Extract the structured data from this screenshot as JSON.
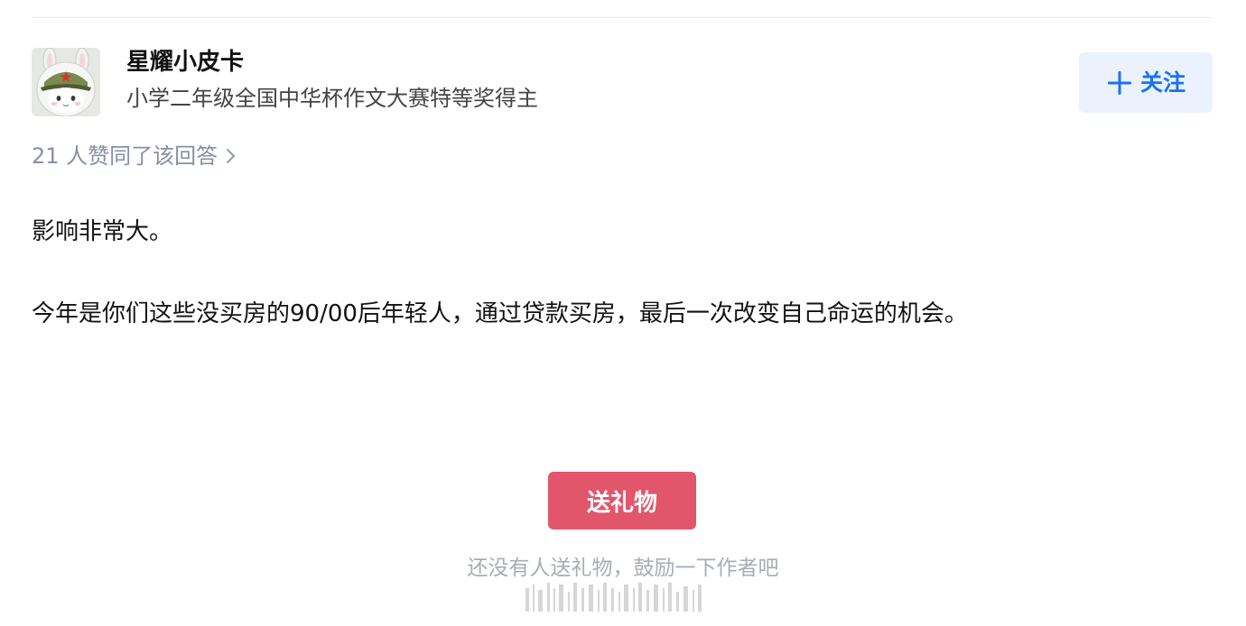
{
  "author": {
    "name": "星耀小皮卡",
    "headline": "小学二年级全国中华杯作文大赛特等奖得主",
    "avatar_icon": "bunny-hood-soldier-avatar"
  },
  "follow_button": {
    "label": "关注",
    "icon": "plus-icon",
    "color": "#1772f6",
    "background": "#ebf2fd"
  },
  "voters": {
    "text": "21 人赞同了该回答",
    "icon": "chevron-right-icon",
    "color": "#8590a6"
  },
  "answer": {
    "paragraphs": [
      "影响非常大。",
      "今年是你们这些没买房的90/00后年轻人，通过贷款买房，最后一次改变自己命运的机会。"
    ]
  },
  "gift": {
    "button_label": "送礼物",
    "hint": "还没有人送礼物，鼓励一下作者吧",
    "button_color": "#e2566b"
  },
  "watermark": {
    "icon": "watermark-barcode-icon"
  }
}
